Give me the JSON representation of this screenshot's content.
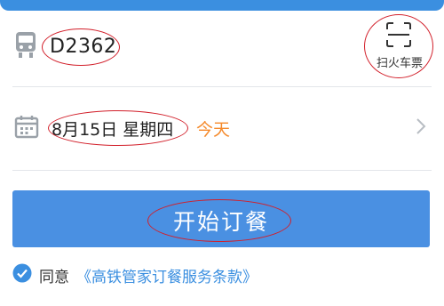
{
  "train": {
    "number": "D2362",
    "scan_label": "扫火车票"
  },
  "date": {
    "value": "8月15日 星期四",
    "today_label": "今天"
  },
  "order": {
    "button_label": "开始订餐"
  },
  "agreement": {
    "prefix": "同意",
    "terms_link": "《高铁管家订餐服务条款》"
  },
  "colors": {
    "brand_blue": "#4a90e2",
    "today_orange": "#f5892a",
    "annotation_red": "#d21f2a"
  },
  "icons": [
    "train-icon",
    "scan-icon",
    "calendar-icon",
    "chevron-right-icon",
    "checkmark-icon"
  ]
}
